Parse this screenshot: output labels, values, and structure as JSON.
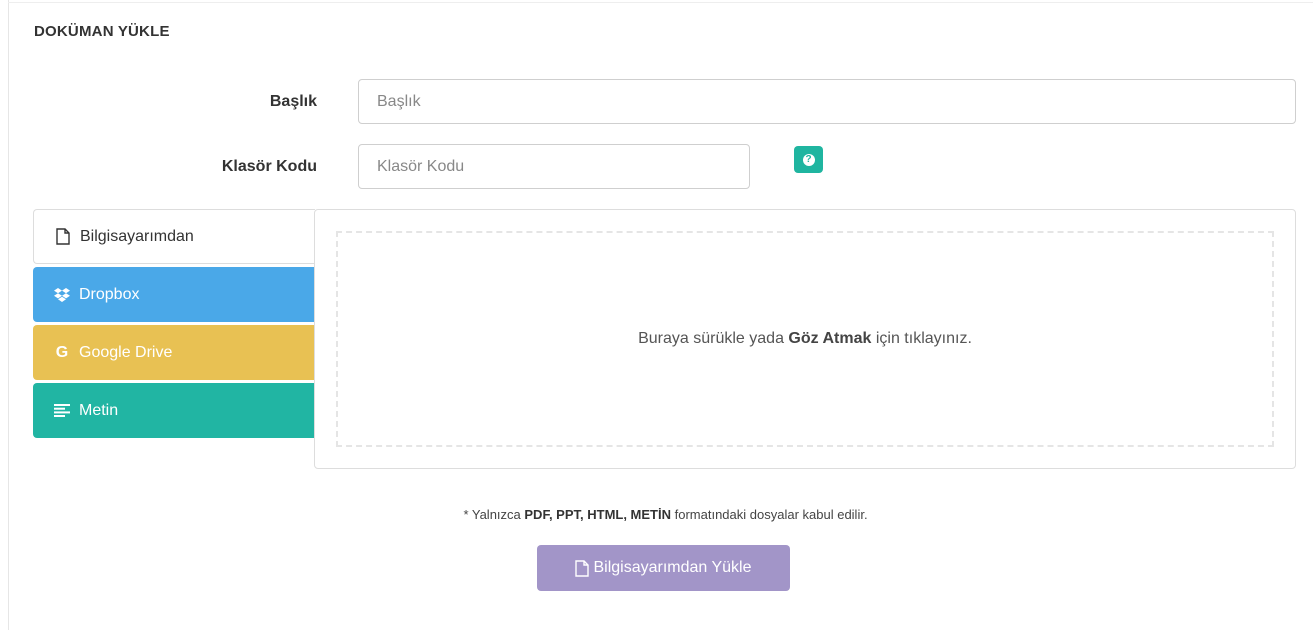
{
  "page": {
    "title": "DOKÜMAN YÜKLE"
  },
  "form": {
    "title_label": "Başlık",
    "title_placeholder": "Başlık",
    "folder_label": "Klasör Kodu",
    "folder_placeholder": "Klasör Kodu",
    "help_icon": "question-circle-icon",
    "help_color": "#1fb5a0"
  },
  "tabs": [
    {
      "label": "Bilgisayarımdan",
      "icon": "file-icon",
      "active": true,
      "color": "#ffffff"
    },
    {
      "label": "Dropbox",
      "icon": "dropbox-icon",
      "active": false,
      "color": "#4aa8e8"
    },
    {
      "label": "Google Drive",
      "icon": "google-icon",
      "active": false,
      "color": "#e8c153"
    },
    {
      "label": "Metin",
      "icon": "text-align-icon",
      "active": false,
      "color": "#21b5a3"
    }
  ],
  "dropzone": {
    "text_before": "Buraya sürükle yada ",
    "text_bold": "Göz Atmak",
    "text_after": " için tıklayınız."
  },
  "note": {
    "prefix": "* Yalnızca ",
    "formats": "PDF, PPT, HTML, METİN",
    "suffix": " formatındaki dosyalar kabul edilir."
  },
  "upload_button": {
    "label": "Bilgisayarımdan Yükle",
    "icon": "file-icon",
    "color": "#a295c8"
  }
}
